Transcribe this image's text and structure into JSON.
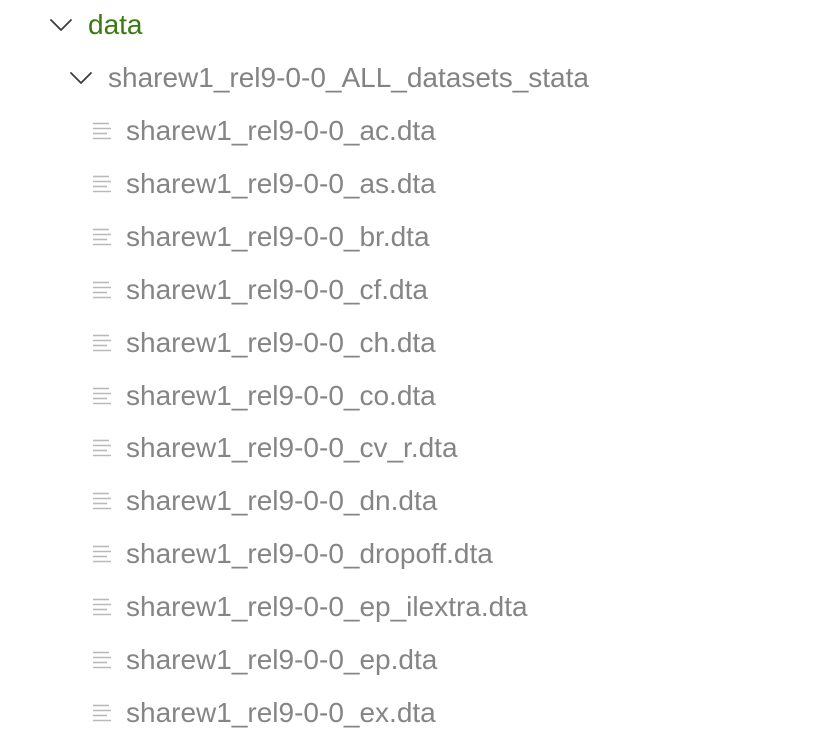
{
  "tree": {
    "root": {
      "label": "data",
      "expanded": true,
      "icon": "chevron-down-icon",
      "color": "#3a7a10"
    },
    "folder": {
      "label": "sharew1_rel9-0-0_ALL_datasets_stata",
      "expanded": true,
      "icon": "chevron-down-icon"
    },
    "files": [
      {
        "label": "sharew1_rel9-0-0_ac.dta",
        "icon": "file-lines-icon"
      },
      {
        "label": "sharew1_rel9-0-0_as.dta",
        "icon": "file-lines-icon"
      },
      {
        "label": "sharew1_rel9-0-0_br.dta",
        "icon": "file-lines-icon"
      },
      {
        "label": "sharew1_rel9-0-0_cf.dta",
        "icon": "file-lines-icon"
      },
      {
        "label": "sharew1_rel9-0-0_ch.dta",
        "icon": "file-lines-icon"
      },
      {
        "label": "sharew1_rel9-0-0_co.dta",
        "icon": "file-lines-icon"
      },
      {
        "label": "sharew1_rel9-0-0_cv_r.dta",
        "icon": "file-lines-icon"
      },
      {
        "label": "sharew1_rel9-0-0_dn.dta",
        "icon": "file-lines-icon"
      },
      {
        "label": "sharew1_rel9-0-0_dropoff.dta",
        "icon": "file-lines-icon"
      },
      {
        "label": "sharew1_rel9-0-0_ep_ilextra.dta",
        "icon": "file-lines-icon"
      },
      {
        "label": "sharew1_rel9-0-0_ep.dta",
        "icon": "file-lines-icon"
      },
      {
        "label": "sharew1_rel9-0-0_ex.dta",
        "icon": "file-lines-icon"
      }
    ]
  }
}
